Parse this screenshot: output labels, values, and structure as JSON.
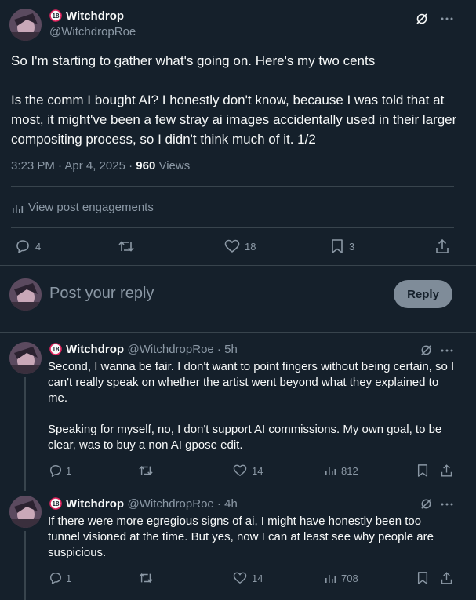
{
  "main_post": {
    "name": "Witchdrop",
    "handle": "@WitchdropRoe",
    "paragraph1": "So I'm starting to gather what's going on. Here's my two cents",
    "paragraph2": "Is the comm I bought AI? I honestly don't know, because I was told that at most, it might've been a few stray ai images accidentally used in their larger compositing process, so I didn't think much of it. 1/2",
    "timestamp": "3:23 PM · Apr 4, 2025 · ",
    "views_count": "960",
    "views_label": " Views",
    "engagements_label": "View post engagements",
    "actions": {
      "replies": "4",
      "reposts": "",
      "likes": "18",
      "bookmarks": "3"
    }
  },
  "composer": {
    "placeholder": "Post your reply",
    "reply_button": "Reply"
  },
  "replies": [
    {
      "name": "Witchdrop",
      "handle": "@WitchdropRoe",
      "time": " · 5h",
      "paragraph1": "Second, I wanna be fair. I don't want to point fingers without being certain, so I can't really speak on whether the artist went beyond what they explained to me.",
      "paragraph2": "Speaking for myself, no, I don't support AI commissions. My own goal, to be clear, was to buy a non AI gpose edit.",
      "replies": "1",
      "likes": "14",
      "views": "812"
    },
    {
      "name": "Witchdrop",
      "handle": "@WitchdropRoe",
      "time": " · 4h",
      "paragraph1": "If there were more egregious signs of ai, I might have honestly been too tunnel visioned at the time. But yes, now I can at least see why people are suspicious.",
      "replies": "1",
      "likes": "14",
      "views": "708"
    }
  ],
  "colors": {
    "background": "#15202b",
    "text": "#f7f9f9",
    "muted": "#8b98a5",
    "divider": "#38444d",
    "reply_button_bg": "#8b98a5",
    "badge_red": "#e0245e"
  },
  "icons": [
    "age-18-badge-icon",
    "grok-slash-icon",
    "more-icon",
    "reply-icon",
    "repost-icon",
    "like-icon",
    "bookmark-icon",
    "share-icon",
    "analytics-icon"
  ]
}
